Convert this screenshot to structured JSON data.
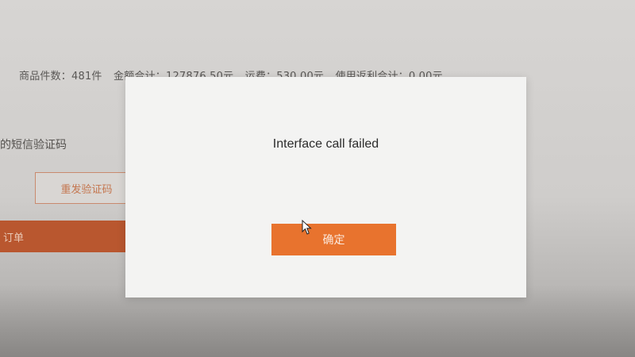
{
  "background": {
    "summary": {
      "item_count": "商品件数：481件",
      "amount_total": "金额合计：127876.50元",
      "shipping": "运费：530.00元",
      "rebate_total": "使用返利合计：0.00元"
    },
    "sms_label": "的短信验证码",
    "resend_button": "重发验证码",
    "submit_button": "订单"
  },
  "dialog": {
    "message": "Interface call failed",
    "confirm_button": "确定"
  },
  "colors": {
    "accent": "#e8732e",
    "dialog_bg": "#f3f3f2"
  }
}
